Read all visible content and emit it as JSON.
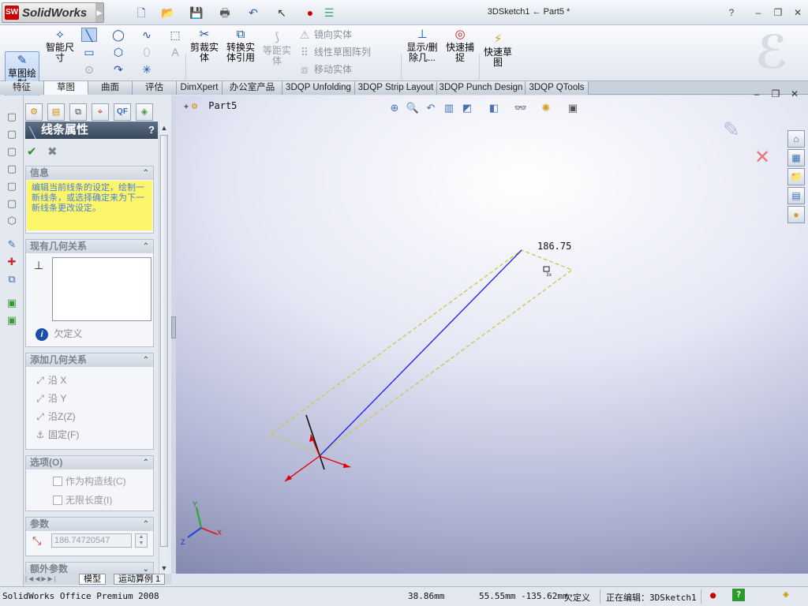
{
  "app": {
    "name": "SolidWorks",
    "logo_badge": "SW",
    "document_title": "3DSketch1 ← Part5 *",
    "window_controls": {
      "help": "?",
      "minimize": "‒",
      "restore": "❐",
      "close": "✕"
    }
  },
  "quick_access": [
    "new-document-icon",
    "open-icon",
    "save-icon",
    "print-icon",
    "undo-icon",
    "select-icon",
    "rebuild-icon",
    "options-icon"
  ],
  "ribbon": {
    "sketch_button": "草图绘制",
    "smart_dimension": "智能尺寸",
    "trim": "剪裁实体",
    "convert": "转换实体引用",
    "offset": "等距实体",
    "mirror": "镜向实体",
    "linear_pattern": "线性草图阵列",
    "move": "移动实体",
    "display_delete": "显示/删除几...",
    "quick_snap": "快速捕捉",
    "rapid_sketch": "快速草图"
  },
  "command_tabs": [
    "特征",
    "草图",
    "曲面",
    "评估",
    "DimXpert",
    "办公室产品",
    "3DQP Unfolding",
    "3DQP Strip Layout",
    "3DQP Punch Design",
    "3DQP QTools"
  ],
  "active_tab": "草图",
  "property_manager": {
    "title": "线条属性",
    "help": "?",
    "ok": "✔",
    "cancel": "✖",
    "info": {
      "title": "信息",
      "text": "编辑当前线条的设定，绘制一新线条，或选择确定来为下一新线条更改设定。"
    },
    "existing_relations": {
      "title": "现有几何关系",
      "status": "欠定义"
    },
    "add_relations": {
      "title": "添加几何关系",
      "items": [
        "沿 X",
        "沿 Y",
        "沿Z(Z)",
        "固定(F)"
      ]
    },
    "options": {
      "title": "选项(O)",
      "construction": "作为构造线(C)",
      "infinite": "无限长度(I)"
    },
    "parameters": {
      "title": "参数",
      "length": "186.74720547"
    },
    "additional": {
      "title": "额外参数"
    }
  },
  "model_tabs": [
    "模型",
    "运动算例 1"
  ],
  "viewport": {
    "tree_node": "Part5",
    "dimension_label": "186.75"
  },
  "status_bar": {
    "product": "SolidWorks Office Premium 2008",
    "length": "38.86mm",
    "coords": "55.55mm -135.62mm",
    "definition": "欠定义",
    "editing": "正在编辑：3DSketch1"
  },
  "colors": {
    "sketch_line": "#1a1aff",
    "guide_dashes": "#c8c84a",
    "origin_axes": "#e00000",
    "info_background": "#fdf56a",
    "info_text": "#4a7fd8"
  }
}
